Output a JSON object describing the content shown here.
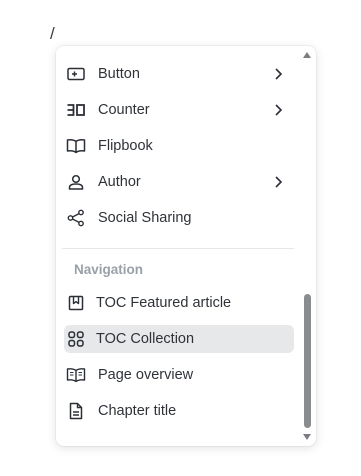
{
  "editor": {
    "slash": "/"
  },
  "menu": {
    "items": [
      {
        "label": "Button",
        "icon": "button-icon",
        "has_submenu": true
      },
      {
        "label": "Counter",
        "icon": "counter-icon",
        "has_submenu": true
      },
      {
        "label": "Flipbook",
        "icon": "book-open-icon",
        "has_submenu": false
      },
      {
        "label": "Author",
        "icon": "user-icon",
        "has_submenu": true
      },
      {
        "label": "Social Sharing",
        "icon": "share-icon",
        "has_submenu": false
      }
    ],
    "section_title": "Navigation",
    "nav_items": [
      {
        "label": "TOC Featured article",
        "icon": "bookmark-icon"
      },
      {
        "label": "TOC Collection",
        "icon": "grid-icon",
        "selected": true
      },
      {
        "label": "Page overview",
        "icon": "open-book-lines-icon"
      },
      {
        "label": "Chapter title",
        "icon": "document-icon"
      }
    ]
  },
  "colors": {
    "selected_bg": "#e7e8ea",
    "section_text": "#9aa0a8",
    "scroll_thumb": "#8a8c90"
  }
}
